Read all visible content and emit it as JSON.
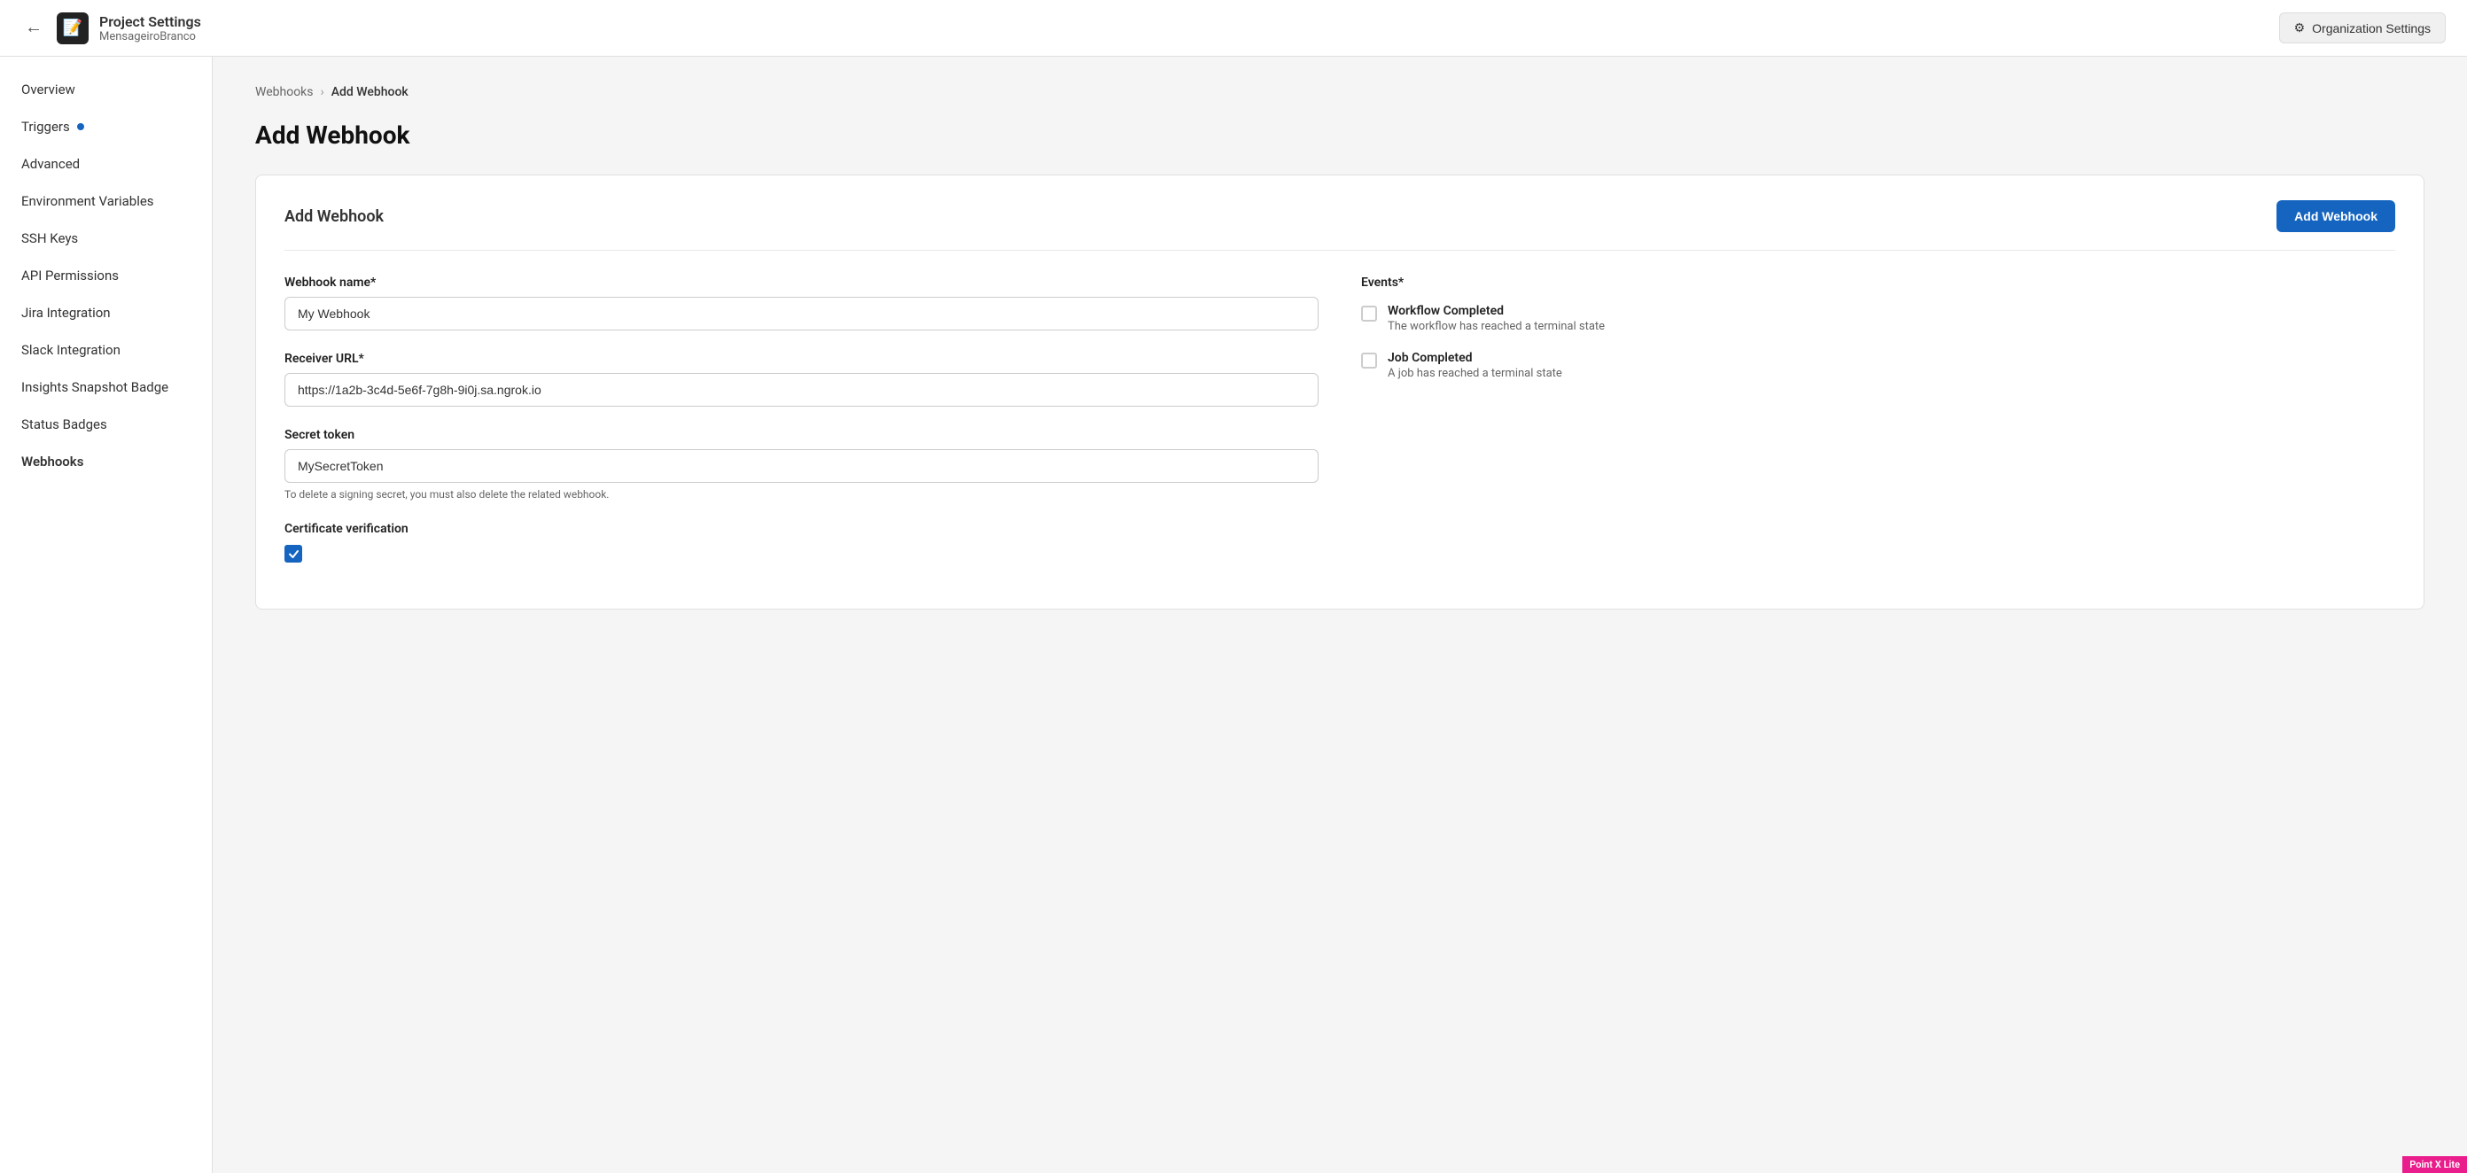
{
  "header": {
    "back_label": "←",
    "project_icon": "📋",
    "project_title": "Project Settings",
    "project_name": "MensageiroBranco",
    "org_settings_label": "Organization Settings",
    "gear_icon": "⚙"
  },
  "sidebar": {
    "items": [
      {
        "id": "overview",
        "label": "Overview",
        "active": false,
        "badge": false
      },
      {
        "id": "triggers",
        "label": "Triggers",
        "active": false,
        "badge": true
      },
      {
        "id": "advanced",
        "label": "Advanced",
        "active": false,
        "badge": false
      },
      {
        "id": "environment-variables",
        "label": "Environment Variables",
        "active": false,
        "badge": false
      },
      {
        "id": "ssh-keys",
        "label": "SSH Keys",
        "active": false,
        "badge": false
      },
      {
        "id": "api-permissions",
        "label": "API Permissions",
        "active": false,
        "badge": false
      },
      {
        "id": "jira-integration",
        "label": "Jira Integration",
        "active": false,
        "badge": false
      },
      {
        "id": "slack-integration",
        "label": "Slack Integration",
        "active": false,
        "badge": false
      },
      {
        "id": "insights-snapshot-badge",
        "label": "Insights Snapshot Badge",
        "active": false,
        "badge": false
      },
      {
        "id": "status-badges",
        "label": "Status Badges",
        "active": false,
        "badge": false
      },
      {
        "id": "webhooks",
        "label": "Webhooks",
        "active": true,
        "badge": false
      }
    ]
  },
  "breadcrumb": {
    "parent": "Webhooks",
    "separator": "›",
    "current": "Add Webhook"
  },
  "page": {
    "title": "Add Webhook"
  },
  "card": {
    "title": "Add Webhook",
    "submit_button": "Add Webhook"
  },
  "form": {
    "webhook_name_label": "Webhook name*",
    "webhook_name_placeholder": "",
    "webhook_name_value": "My Webhook",
    "receiver_url_label": "Receiver URL*",
    "receiver_url_value": "https://1a2b-3c4d-5e6f-7g8h-9i0j.sa.ngrok.io",
    "secret_token_label": "Secret token",
    "secret_token_value": "MySecretToken",
    "secret_token_hint": "To delete a signing secret, you must also delete the related webhook.",
    "cert_verification_label": "Certificate verification",
    "events_label": "Events*",
    "events": [
      {
        "id": "workflow-completed",
        "name": "Workflow Completed",
        "description": "The workflow has reached a terminal state",
        "checked": false
      },
      {
        "id": "job-completed",
        "name": "Job Completed",
        "description": "A job has reached a terminal state",
        "checked": false
      }
    ]
  },
  "point_badge": "Point X Lite"
}
